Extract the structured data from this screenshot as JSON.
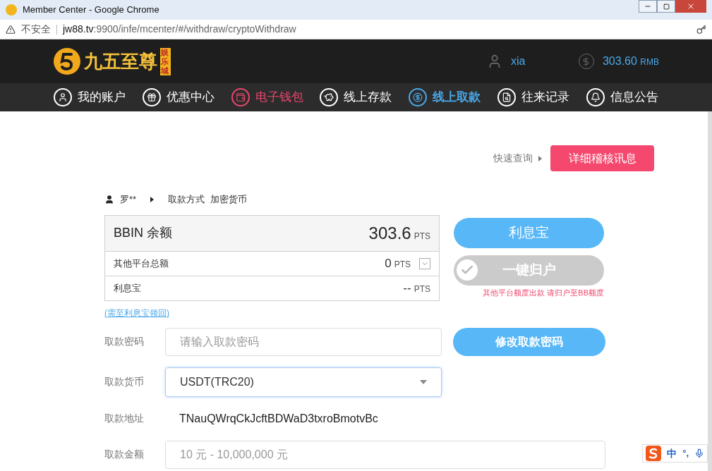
{
  "window": {
    "title": "Member Center - Google Chrome"
  },
  "address_bar": {
    "security": "不安全",
    "url_host": "jw88.tv",
    "url_rest": ":9900/infe/mcenter/#/withdraw/cryptoWithdraw"
  },
  "header": {
    "logo_text": "九五至尊",
    "logo_badge": "娱乐城",
    "username": "xia",
    "balance": "303.60",
    "currency": "RMB"
  },
  "nav": [
    {
      "label": "我的账户",
      "selected": false,
      "color": "#ffffff"
    },
    {
      "label": "优惠中心",
      "selected": false,
      "color": "#ffffff"
    },
    {
      "label": "电子钱包",
      "selected": false,
      "color": "#e8466e"
    },
    {
      "label": "线上存款",
      "selected": false,
      "color": "#ffffff"
    },
    {
      "label": "线上取款",
      "selected": true,
      "color": "#4aa8e8"
    },
    {
      "label": "往来记录",
      "selected": false,
      "color": "#ffffff"
    },
    {
      "label": "信息公告",
      "selected": false,
      "color": "#ffffff"
    }
  ],
  "quick_query": {
    "label": "快速查询",
    "button": "详细稽核讯息"
  },
  "breadcrumb": {
    "user": "罗**",
    "method_label": "取款方式",
    "method": "加密货币"
  },
  "balances": [
    {
      "kind": "main",
      "label": "BBIN 余额",
      "amount": "303.6",
      "unit": "PTS"
    },
    {
      "kind": "expandable",
      "label": "其他平台总额",
      "amount": "0",
      "unit": "PTS",
      "expanded": false
    },
    {
      "kind": "plain",
      "label": "利息宝",
      "amount": "--",
      "unit": "PTS"
    }
  ],
  "interest_link": "(需至利息宝领回)",
  "side_buttons": {
    "interest": "利息宝",
    "collect": "一键归户",
    "collect_disabled": true,
    "collect_note": "其他平台额度出款 请归户至BB额度"
  },
  "form": [
    {
      "kind": "password",
      "label": "取款密码",
      "placeholder": "请输入取款密码",
      "button": "修改取款密码"
    },
    {
      "kind": "select",
      "label": "取款货币",
      "value": "USDT(TRC20)"
    },
    {
      "kind": "text",
      "label": "取款地址",
      "value": "TNauQWrqCkJcftBDWaD3txroBmotvBc"
    },
    {
      "kind": "amount",
      "label": "取款金额",
      "placeholder": "10 元 - 10,000,000 元"
    }
  ],
  "ime": {
    "mode": "中",
    "punct": "°,"
  }
}
